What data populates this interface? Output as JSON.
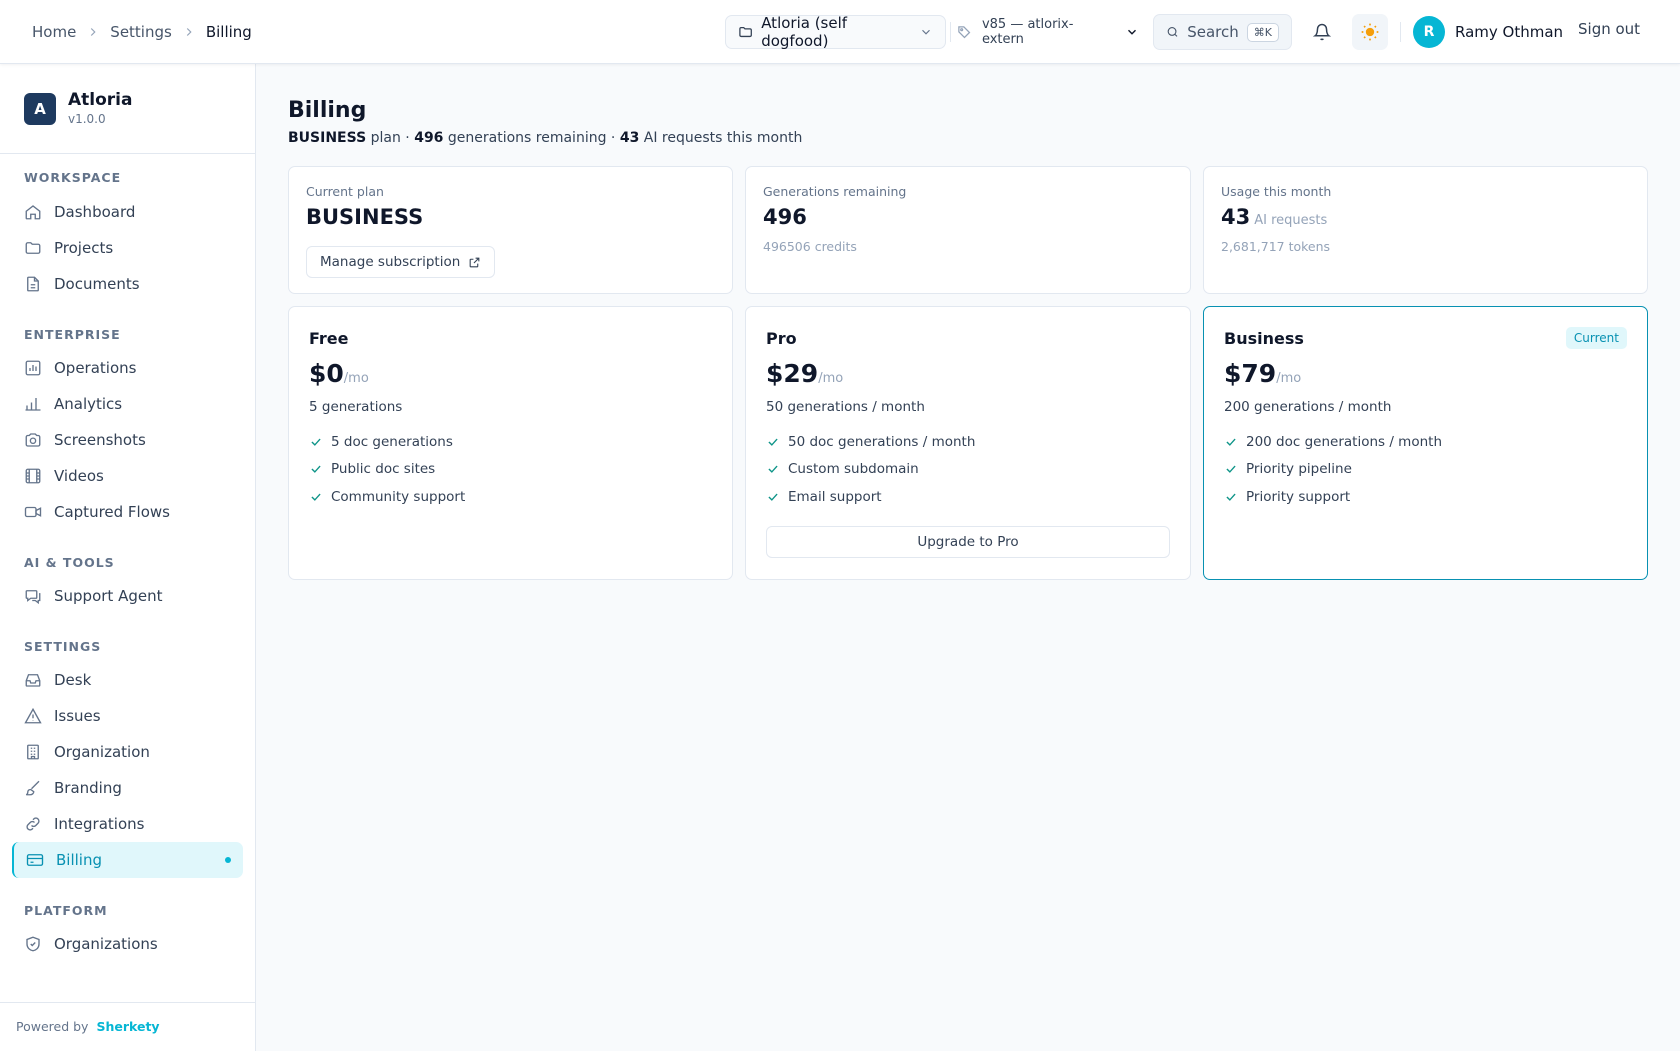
{
  "breadcrumb": [
    "Home",
    "Settings",
    "Billing"
  ],
  "header": {
    "project": "Atloria (self dogfood)",
    "version": "v85 — atlorix-extern",
    "search_label": "Search",
    "search_shortcut": "⌘K",
    "user_initial": "R",
    "user_name": "Ramy Othman",
    "sign_out": "Sign out"
  },
  "brand": {
    "name": "Atloria",
    "version": "v1.0.0",
    "logo_letter": "A"
  },
  "sidebar": {
    "sections": [
      {
        "title": "WORKSPACE",
        "items": [
          {
            "label": "Dashboard",
            "icon": "home-icon"
          },
          {
            "label": "Projects",
            "icon": "folder-icon"
          },
          {
            "label": "Documents",
            "icon": "document-icon"
          }
        ]
      },
      {
        "title": "ENTERPRISE",
        "items": [
          {
            "label": "Operations",
            "icon": "operations-icon"
          },
          {
            "label": "Analytics",
            "icon": "bar-chart-icon"
          },
          {
            "label": "Screenshots",
            "icon": "camera-icon"
          },
          {
            "label": "Videos",
            "icon": "film-icon"
          },
          {
            "label": "Captured Flows",
            "icon": "video-camera-icon"
          }
        ]
      },
      {
        "title": "AI & TOOLS",
        "items": [
          {
            "label": "Support Agent",
            "icon": "chat-icon"
          }
        ]
      },
      {
        "title": "SETTINGS",
        "items": [
          {
            "label": "Desk",
            "icon": "inbox-icon"
          },
          {
            "label": "Issues",
            "icon": "warning-icon"
          },
          {
            "label": "Organization",
            "icon": "building-icon"
          },
          {
            "label": "Branding",
            "icon": "brush-icon"
          },
          {
            "label": "Integrations",
            "icon": "link-icon"
          },
          {
            "label": "Billing",
            "icon": "credit-card-icon",
            "active": true
          }
        ]
      },
      {
        "title": "PLATFORM",
        "items": [
          {
            "label": "Organizations",
            "icon": "shield-icon"
          }
        ]
      }
    ],
    "powered_by_label": "Powered by",
    "powered_by_name": "Sherkety"
  },
  "page": {
    "title": "Billing",
    "summary": {
      "plan": "BUSINESS",
      "plan_suffix": "plan ·",
      "generations": "496",
      "generations_suffix": "generations remaining ·",
      "requests": "43",
      "requests_suffix": "AI requests this month"
    }
  },
  "stats": {
    "current_plan": {
      "label": "Current plan",
      "value": "BUSINESS",
      "button": "Manage subscription"
    },
    "generations": {
      "label": "Generations remaining",
      "value": "496",
      "sub": "496506 credits"
    },
    "usage": {
      "label": "Usage this month",
      "value": "43",
      "unit": "AI requests",
      "sub": "2,681,717 tokens"
    }
  },
  "plans": [
    {
      "name": "Free",
      "price": "$0",
      "period": "/mo",
      "desc": "5 generations",
      "features": [
        "5 doc generations",
        "Public doc sites",
        "Community support"
      ]
    },
    {
      "name": "Pro",
      "price": "$29",
      "period": "/mo",
      "desc": "50 generations / month",
      "features": [
        "50 doc generations / month",
        "Custom subdomain",
        "Email support"
      ],
      "button": "Upgrade to Pro"
    },
    {
      "name": "Business",
      "price": "$79",
      "period": "/mo",
      "desc": "200 generations / month",
      "features": [
        "200 doc generations / month",
        "Priority pipeline",
        "Priority support"
      ],
      "badge": "Current"
    }
  ],
  "colors": {
    "accent": "#06b6d4",
    "accent_dark": "#0891b2",
    "check": "#0d9488",
    "brand_logo": "#1e3a5f"
  }
}
